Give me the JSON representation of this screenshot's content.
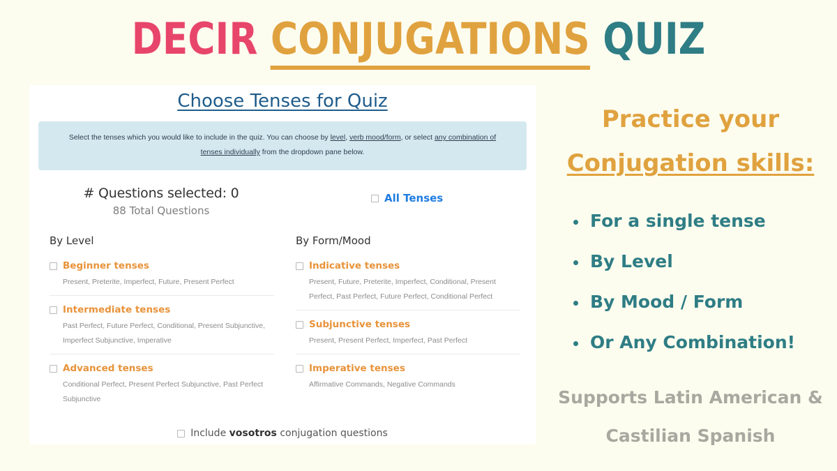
{
  "hero": {
    "word1": "DECIR",
    "word2": "CONJUGATIONS",
    "word3": "QUIZ",
    "color1": "#E8456B",
    "color2": "#E0A23F",
    "color3": "#2F7D85"
  },
  "panel": {
    "heading": "Choose Tenses for Quiz",
    "info": {
      "part1": "Select the tenses which you would like to include in the quiz. You can choose by ",
      "link1": "level",
      "part2": ", ",
      "link2": "verb mood/form",
      "part3": ", or select ",
      "link3": "any combination of tenses individually",
      "part4": " from the dropdown pane below."
    },
    "counts": {
      "selected_label": "# Questions selected: 0",
      "total_label": "88 Total Questions"
    },
    "all_tenses": {
      "label": "All Tenses",
      "color": "#1F7DE0",
      "checked": false
    },
    "by_level": {
      "title": "By Level",
      "groups": [
        {
          "label": "Beginner tenses",
          "tenses": "Present, Preterite, Imperfect, Future, Present Perfect",
          "checked": false
        },
        {
          "label": "Intermediate tenses",
          "tenses": "Past Perfect, Future Perfect, Conditional, Present Subjunctive, Imperfect Subjunctive, Imperative",
          "checked": false
        },
        {
          "label": "Advanced tenses",
          "tenses": "Conditional Perfect, Present Perfect Subjunctive, Past Perfect Subjunctive",
          "checked": false
        }
      ]
    },
    "by_form_mood": {
      "title": "By Form/Mood",
      "groups": [
        {
          "label": "Indicative tenses",
          "tenses": "Present, Future, Preterite, Imperfect, Conditional, Present Perfect, Past Perfect, Future Perfect, Conditional Perfect",
          "checked": false
        },
        {
          "label": "Subjunctive tenses",
          "tenses": "Present, Present Perfect, Imperfect, Past Perfect",
          "checked": false
        },
        {
          "label": "Imperative tenses",
          "tenses": "Affirmative Commands, Negative Commands",
          "checked": false
        }
      ]
    },
    "vosotros": {
      "prefix": "Include ",
      "bold": "vosotros",
      "suffix": " conjugation questions",
      "checked": false
    }
  },
  "right": {
    "head_line1": "Practice your",
    "head_line2": "Conjugation skills:",
    "bullets": [
      "For a single tense",
      "By Level",
      "By Mood / Form",
      "Or Any Combination!"
    ],
    "footer_line1": "Supports Latin American &",
    "footer_line2": "Castilian Spanish"
  }
}
